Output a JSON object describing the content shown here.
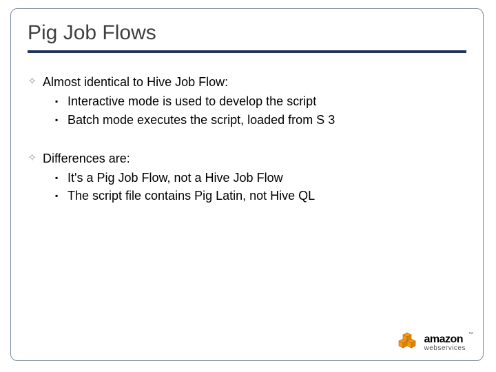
{
  "title": "Pig Job Flows",
  "bullets": {
    "b1": "Almost identical to Hive Job Flow:",
    "b1_1": "Interactive mode is used to develop the script",
    "b1_2": "Batch mode executes the script, loaded from S 3",
    "b2": "Differences are:",
    "b2_1": "It's a Pig Job Flow, not a Hive Job Flow",
    "b2_2": "The script file contains Pig Latin, not Hive QL"
  },
  "logo": {
    "brand_top": "amazon",
    "brand_bottom": "webservices",
    "tm": "™"
  }
}
